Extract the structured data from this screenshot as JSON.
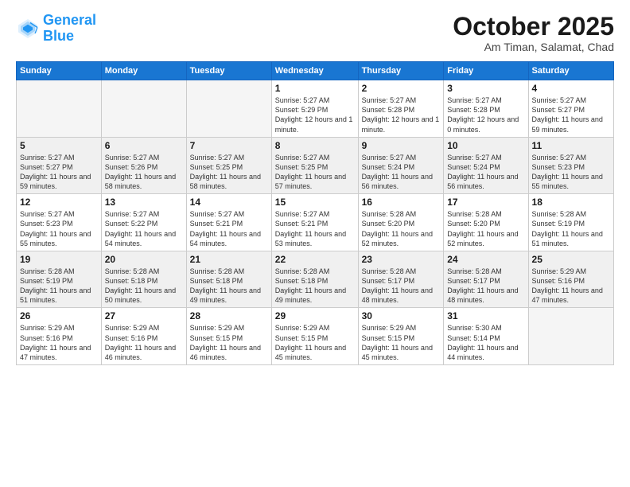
{
  "header": {
    "logo_line1": "General",
    "logo_line2": "Blue",
    "month_title": "October 2025",
    "location": "Am Timan, Salamat, Chad"
  },
  "weekdays": [
    "Sunday",
    "Monday",
    "Tuesday",
    "Wednesday",
    "Thursday",
    "Friday",
    "Saturday"
  ],
  "weeks": [
    [
      {
        "day": "",
        "sunrise": "",
        "sunset": "",
        "daylight": "",
        "empty": true
      },
      {
        "day": "",
        "sunrise": "",
        "sunset": "",
        "daylight": "",
        "empty": true
      },
      {
        "day": "",
        "sunrise": "",
        "sunset": "",
        "daylight": "",
        "empty": true
      },
      {
        "day": "1",
        "sunrise": "Sunrise: 5:27 AM",
        "sunset": "Sunset: 5:29 PM",
        "daylight": "Daylight: 12 hours and 1 minute.",
        "empty": false
      },
      {
        "day": "2",
        "sunrise": "Sunrise: 5:27 AM",
        "sunset": "Sunset: 5:28 PM",
        "daylight": "Daylight: 12 hours and 1 minute.",
        "empty": false
      },
      {
        "day": "3",
        "sunrise": "Sunrise: 5:27 AM",
        "sunset": "Sunset: 5:28 PM",
        "daylight": "Daylight: 12 hours and 0 minutes.",
        "empty": false
      },
      {
        "day": "4",
        "sunrise": "Sunrise: 5:27 AM",
        "sunset": "Sunset: 5:27 PM",
        "daylight": "Daylight: 11 hours and 59 minutes.",
        "empty": false
      }
    ],
    [
      {
        "day": "5",
        "sunrise": "Sunrise: 5:27 AM",
        "sunset": "Sunset: 5:27 PM",
        "daylight": "Daylight: 11 hours and 59 minutes.",
        "empty": false
      },
      {
        "day": "6",
        "sunrise": "Sunrise: 5:27 AM",
        "sunset": "Sunset: 5:26 PM",
        "daylight": "Daylight: 11 hours and 58 minutes.",
        "empty": false
      },
      {
        "day": "7",
        "sunrise": "Sunrise: 5:27 AM",
        "sunset": "Sunset: 5:25 PM",
        "daylight": "Daylight: 11 hours and 58 minutes.",
        "empty": false
      },
      {
        "day": "8",
        "sunrise": "Sunrise: 5:27 AM",
        "sunset": "Sunset: 5:25 PM",
        "daylight": "Daylight: 11 hours and 57 minutes.",
        "empty": false
      },
      {
        "day": "9",
        "sunrise": "Sunrise: 5:27 AM",
        "sunset": "Sunset: 5:24 PM",
        "daylight": "Daylight: 11 hours and 56 minutes.",
        "empty": false
      },
      {
        "day": "10",
        "sunrise": "Sunrise: 5:27 AM",
        "sunset": "Sunset: 5:24 PM",
        "daylight": "Daylight: 11 hours and 56 minutes.",
        "empty": false
      },
      {
        "day": "11",
        "sunrise": "Sunrise: 5:27 AM",
        "sunset": "Sunset: 5:23 PM",
        "daylight": "Daylight: 11 hours and 55 minutes.",
        "empty": false
      }
    ],
    [
      {
        "day": "12",
        "sunrise": "Sunrise: 5:27 AM",
        "sunset": "Sunset: 5:23 PM",
        "daylight": "Daylight: 11 hours and 55 minutes.",
        "empty": false
      },
      {
        "day": "13",
        "sunrise": "Sunrise: 5:27 AM",
        "sunset": "Sunset: 5:22 PM",
        "daylight": "Daylight: 11 hours and 54 minutes.",
        "empty": false
      },
      {
        "day": "14",
        "sunrise": "Sunrise: 5:27 AM",
        "sunset": "Sunset: 5:21 PM",
        "daylight": "Daylight: 11 hours and 54 minutes.",
        "empty": false
      },
      {
        "day": "15",
        "sunrise": "Sunrise: 5:27 AM",
        "sunset": "Sunset: 5:21 PM",
        "daylight": "Daylight: 11 hours and 53 minutes.",
        "empty": false
      },
      {
        "day": "16",
        "sunrise": "Sunrise: 5:28 AM",
        "sunset": "Sunset: 5:20 PM",
        "daylight": "Daylight: 11 hours and 52 minutes.",
        "empty": false
      },
      {
        "day": "17",
        "sunrise": "Sunrise: 5:28 AM",
        "sunset": "Sunset: 5:20 PM",
        "daylight": "Daylight: 11 hours and 52 minutes.",
        "empty": false
      },
      {
        "day": "18",
        "sunrise": "Sunrise: 5:28 AM",
        "sunset": "Sunset: 5:19 PM",
        "daylight": "Daylight: 11 hours and 51 minutes.",
        "empty": false
      }
    ],
    [
      {
        "day": "19",
        "sunrise": "Sunrise: 5:28 AM",
        "sunset": "Sunset: 5:19 PM",
        "daylight": "Daylight: 11 hours and 51 minutes.",
        "empty": false
      },
      {
        "day": "20",
        "sunrise": "Sunrise: 5:28 AM",
        "sunset": "Sunset: 5:18 PM",
        "daylight": "Daylight: 11 hours and 50 minutes.",
        "empty": false
      },
      {
        "day": "21",
        "sunrise": "Sunrise: 5:28 AM",
        "sunset": "Sunset: 5:18 PM",
        "daylight": "Daylight: 11 hours and 49 minutes.",
        "empty": false
      },
      {
        "day": "22",
        "sunrise": "Sunrise: 5:28 AM",
        "sunset": "Sunset: 5:18 PM",
        "daylight": "Daylight: 11 hours and 49 minutes.",
        "empty": false
      },
      {
        "day": "23",
        "sunrise": "Sunrise: 5:28 AM",
        "sunset": "Sunset: 5:17 PM",
        "daylight": "Daylight: 11 hours and 48 minutes.",
        "empty": false
      },
      {
        "day": "24",
        "sunrise": "Sunrise: 5:28 AM",
        "sunset": "Sunset: 5:17 PM",
        "daylight": "Daylight: 11 hours and 48 minutes.",
        "empty": false
      },
      {
        "day": "25",
        "sunrise": "Sunrise: 5:29 AM",
        "sunset": "Sunset: 5:16 PM",
        "daylight": "Daylight: 11 hours and 47 minutes.",
        "empty": false
      }
    ],
    [
      {
        "day": "26",
        "sunrise": "Sunrise: 5:29 AM",
        "sunset": "Sunset: 5:16 PM",
        "daylight": "Daylight: 11 hours and 47 minutes.",
        "empty": false
      },
      {
        "day": "27",
        "sunrise": "Sunrise: 5:29 AM",
        "sunset": "Sunset: 5:16 PM",
        "daylight": "Daylight: 11 hours and 46 minutes.",
        "empty": false
      },
      {
        "day": "28",
        "sunrise": "Sunrise: 5:29 AM",
        "sunset": "Sunset: 5:15 PM",
        "daylight": "Daylight: 11 hours and 46 minutes.",
        "empty": false
      },
      {
        "day": "29",
        "sunrise": "Sunrise: 5:29 AM",
        "sunset": "Sunset: 5:15 PM",
        "daylight": "Daylight: 11 hours and 45 minutes.",
        "empty": false
      },
      {
        "day": "30",
        "sunrise": "Sunrise: 5:29 AM",
        "sunset": "Sunset: 5:15 PM",
        "daylight": "Daylight: 11 hours and 45 minutes.",
        "empty": false
      },
      {
        "day": "31",
        "sunrise": "Sunrise: 5:30 AM",
        "sunset": "Sunset: 5:14 PM",
        "daylight": "Daylight: 11 hours and 44 minutes.",
        "empty": false
      },
      {
        "day": "",
        "sunrise": "",
        "sunset": "",
        "daylight": "",
        "empty": true
      }
    ]
  ]
}
